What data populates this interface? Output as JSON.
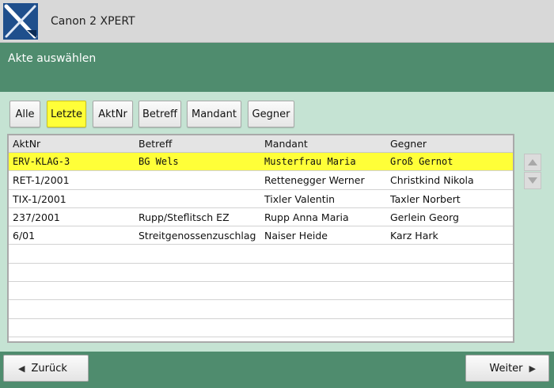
{
  "app": {
    "title": "Canon 2 XPERT"
  },
  "header": {
    "title": "Akte auswählen"
  },
  "filters": {
    "buttons": [
      {
        "label": "Alle",
        "active": false
      },
      {
        "label": "Letzte",
        "active": true
      },
      {
        "label": "AktNr",
        "active": false
      },
      {
        "label": "Betreff",
        "active": false
      },
      {
        "label": "Mandant",
        "active": false
      },
      {
        "label": "Gegner",
        "active": false
      }
    ]
  },
  "table": {
    "columns": [
      "AktNr",
      "Betreff",
      "Mandant",
      "Gegner"
    ],
    "rows": [
      {
        "aktnr": "ERV-KLAG-3",
        "betreff": "BG Wels",
        "mandant": "Musterfrau Maria",
        "gegner": "Groß Gernot",
        "selected": true
      },
      {
        "aktnr": "RET-1/2001",
        "betreff": "",
        "mandant": "Rettenegger Werner",
        "gegner": "Christkind Nikola",
        "selected": false
      },
      {
        "aktnr": "TIX-1/2001",
        "betreff": "",
        "mandant": "Tixler Valentin",
        "gegner": "Taxler Norbert",
        "selected": false
      },
      {
        "aktnr": "237/2001",
        "betreff": "Rupp/Steflitsch EZ",
        "mandant": "Rupp Anna Maria",
        "gegner": "Gerlein Georg",
        "selected": false
      },
      {
        "aktnr": "6/01",
        "betreff": "Streitgenossenzuschlag",
        "mandant": "Naiser Heide",
        "gegner": "Karz Hark",
        "selected": false
      },
      {
        "aktnr": "",
        "betreff": "",
        "mandant": "",
        "gegner": "",
        "selected": false
      },
      {
        "aktnr": "",
        "betreff": "",
        "mandant": "",
        "gegner": "",
        "selected": false
      },
      {
        "aktnr": "",
        "betreff": "",
        "mandant": "",
        "gegner": "",
        "selected": false
      },
      {
        "aktnr": "",
        "betreff": "",
        "mandant": "",
        "gegner": "",
        "selected": false
      },
      {
        "aktnr": "",
        "betreff": "",
        "mandant": "",
        "gegner": "",
        "selected": false
      }
    ]
  },
  "scroll": {
    "up_icon": "triangle-up-icon",
    "down_icon": "triangle-down-icon"
  },
  "footer": {
    "back_label": "Zurück",
    "next_label": "Weiter"
  },
  "colors": {
    "header_green": "#4f8c6e",
    "content_bg": "#c5e3d3",
    "highlight_yellow": "#ffff38",
    "logo_blue": "#1f4f8c"
  }
}
